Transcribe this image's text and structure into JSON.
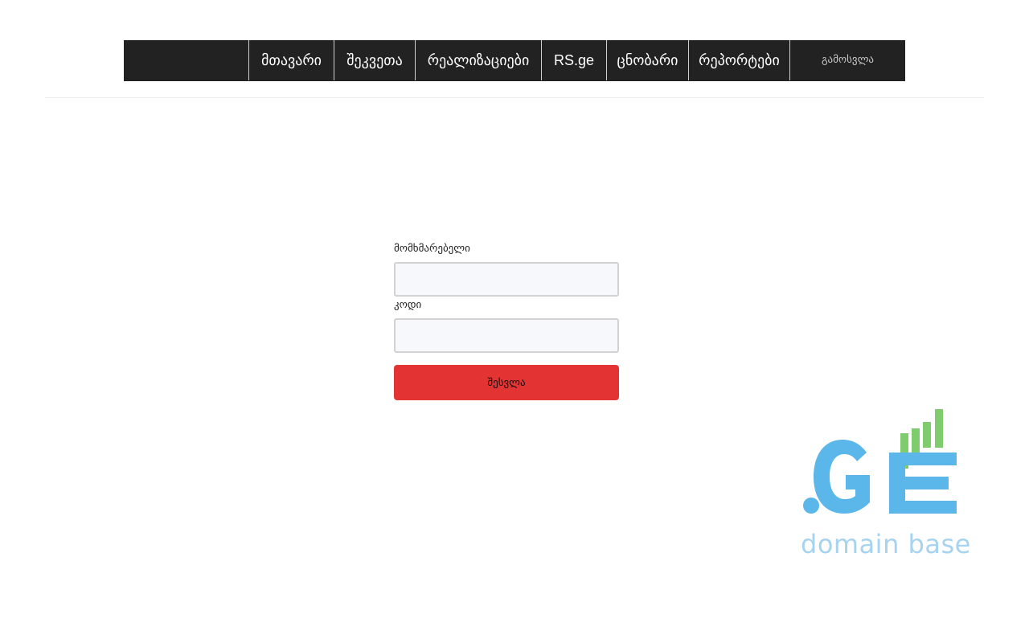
{
  "nav": {
    "items": [
      {
        "label": "მთავარი"
      },
      {
        "label": "შეკვეთა"
      },
      {
        "label": "რეალიზაციები"
      },
      {
        "label": "RS.ge"
      },
      {
        "label": "ცნობარი"
      },
      {
        "label": "რეპორტები"
      }
    ],
    "logout_label": "გამოსვლა"
  },
  "login": {
    "username_label": "მომხმარებელი",
    "username_value": "",
    "password_label": "კოდი",
    "password_value": "",
    "submit_label": "შესვლა"
  },
  "logo": {
    "main_text": ".GE",
    "sub_text": "domain base",
    "colors": {
      "blue": "#5bb7ea",
      "green": "#7fcc6e",
      "light_blue": "#a6d3ef"
    }
  },
  "colors": {
    "navbar_bg": "#222222",
    "accent_red": "#e43333"
  }
}
